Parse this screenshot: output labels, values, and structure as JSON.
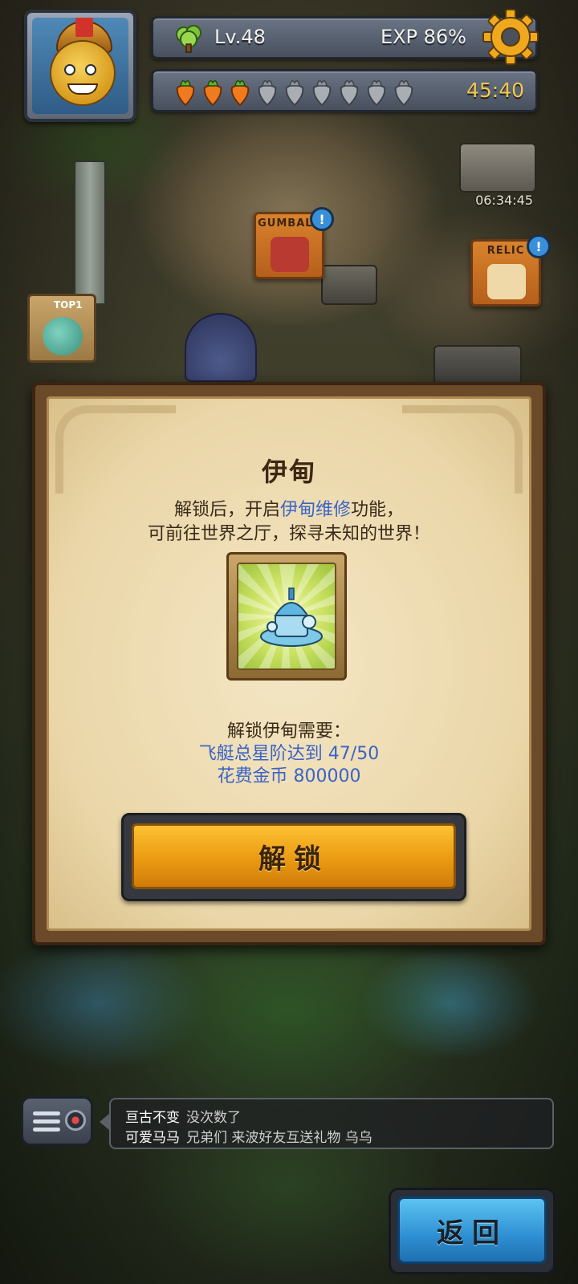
{
  "hud": {
    "level_label": "Lv.48",
    "exp_label": "EXP 86%",
    "energy": {
      "filled": 3,
      "total": 9
    },
    "energy_timer": "45:40"
  },
  "map": {
    "signs": [
      "GUMBALL",
      "RELIC",
      "TOP1"
    ],
    "chest_timer": "06:34:45",
    "alert_mark": "!"
  },
  "dialog": {
    "title": "伊甸",
    "desc_line1_pre": "解锁后，开启",
    "desc_line1_highlight": "伊甸维修",
    "desc_line1_post": "功能，",
    "desc_line2": "可前往世界之厅，探寻未知的世界！",
    "requirement_title": "解锁伊甸需要：",
    "requirement_1": "飞艇总星阶达到 47/50",
    "requirement_2": "花费金币 800000",
    "unlock_label": "解锁"
  },
  "chat": {
    "messages": [
      {
        "name": "亘古不变",
        "text": "没次数了"
      },
      {
        "name": "可爱马马",
        "text": "兄弟们 来波好友互送礼物 乌乌"
      }
    ]
  },
  "back_label": "返回",
  "colors": {
    "highlight_blue": "#3a63c9",
    "timer_gold": "#f5c84a",
    "unlock_orange": "#eb9a12",
    "back_blue": "#2e8fd2"
  }
}
